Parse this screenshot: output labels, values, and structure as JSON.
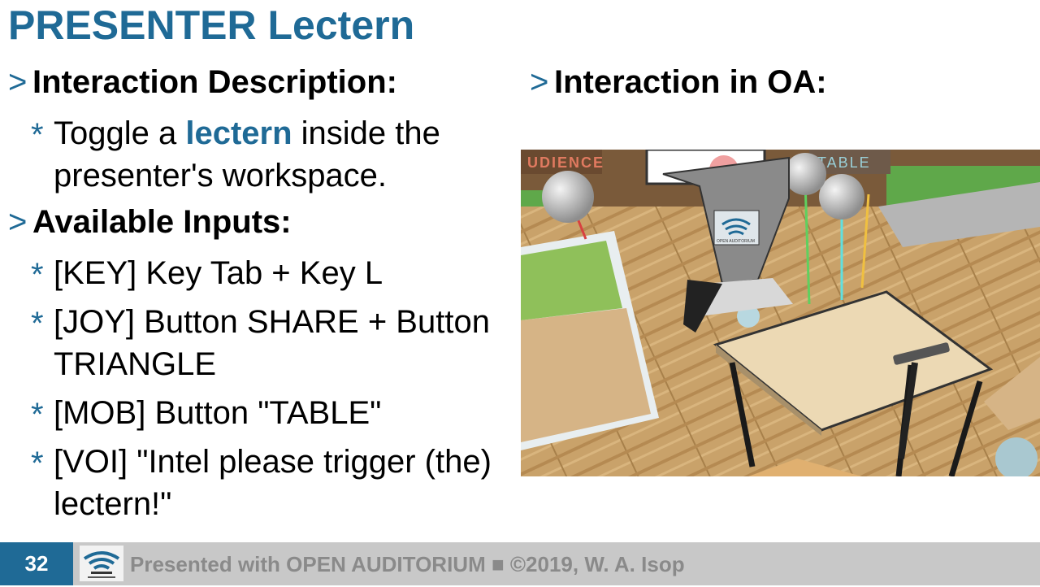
{
  "slide": {
    "title": "PRESENTER Lectern",
    "left_column": {
      "heading1": "Interaction Description:",
      "desc_part1": "Toggle a ",
      "desc_highlight": "lectern",
      "desc_part2": " inside the presenter's workspace.",
      "heading2": "Available Inputs:",
      "inputs": [
        "[KEY] Key Tab + Key L",
        "[JOY] Button SHARE + Button TRIANGLE",
        "[MOB] Button \"TABLE\"",
        "[VOI] \"Intel please trigger (the) lectern!\""
      ]
    },
    "right_column": {
      "heading": "Interaction in OA:",
      "scene_labels": {
        "audience": "UDIENCE",
        "table": "TABLE",
        "lectern_logo": "OPEN AUDITORIUM"
      }
    },
    "markers": {
      "level1": ">",
      "level2": "*"
    }
  },
  "footer": {
    "page_number": "32",
    "text": "Presented with OPEN AUDITORIUM ■ ©2019, W. A. Isop"
  },
  "colors": {
    "accent": "#1f6a96",
    "footer_bg": "#c8c8c8",
    "footer_text": "#8a8a8a"
  }
}
